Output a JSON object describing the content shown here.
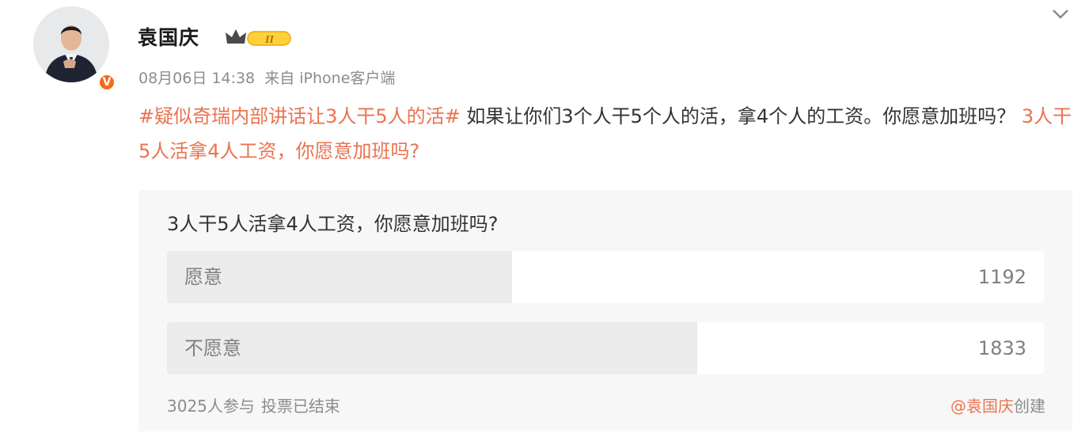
{
  "post": {
    "author": "袁国庆",
    "vip_level": "II",
    "verified_mark": "V",
    "date": "08月06日 14:38",
    "source": "来自 iPhone客户端",
    "text_hashtag": "#疑似奇瑞内部讲话让3人干5人的活#",
    "text_body": " 如果让你们3个人干5个人的活，拿4个人的工资。你愿意加班吗？ ",
    "text_poll_link": "3人干5人活拿4人工资，你愿意加班吗?"
  },
  "poll": {
    "title": "3人干5人活拿4人工资，你愿意加班吗?",
    "options": [
      {
        "label": "愿意",
        "count": "1192",
        "fraction": 0.3932
      },
      {
        "label": "不愿意",
        "count": "1833",
        "fraction": 0.6047
      }
    ],
    "participants": "3025人参与",
    "status": "投票已结束",
    "creator": "@袁国庆",
    "created_suffix": "创建"
  },
  "colors": {
    "link": "#eb7350",
    "verified": "#f26b1d",
    "bar_fill": "#ececec"
  },
  "icons": {
    "expand": "chevron-down-icon",
    "vip": "crown-icon",
    "verified": "verified-v-icon"
  }
}
